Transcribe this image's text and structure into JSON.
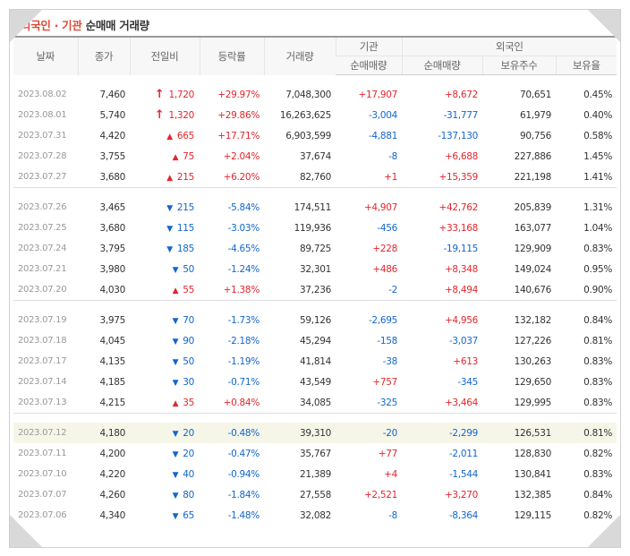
{
  "title": {
    "accent": "외국인 · 기관",
    "rest": "순매매 거래량"
  },
  "headers": {
    "date": "날짜",
    "close": "종가",
    "change": "전일비",
    "rate": "등락률",
    "volume": "거래량",
    "inst": "기관",
    "foreign": "외국인",
    "inst_net": "순매매량",
    "foreign_net": "순매매량",
    "holdings": "보유주수",
    "ratio": "보유율"
  },
  "groups": [
    [
      {
        "date": "2023.08.02",
        "close": "7,460",
        "icon": "upper-limit-arrow-icon",
        "dir": "up",
        "change": "1,720",
        "rate": "+29.97%",
        "volume": "7,048,300",
        "inst": "+17,907",
        "foreign": "+8,672",
        "holdings": "70,651",
        "ratio": "0.45%"
      },
      {
        "date": "2023.08.01",
        "close": "5,740",
        "icon": "upper-limit-arrow-icon",
        "dir": "up",
        "change": "1,320",
        "rate": "+29.86%",
        "volume": "16,263,625",
        "inst": "-3,004",
        "foreign": "-31,777",
        "holdings": "61,979",
        "ratio": "0.40%"
      },
      {
        "date": "2023.07.31",
        "close": "4,420",
        "icon": "up-triangle-icon",
        "dir": "up",
        "change": "665",
        "rate": "+17.71%",
        "volume": "6,903,599",
        "inst": "-4,881",
        "foreign": "-137,130",
        "holdings": "90,756",
        "ratio": "0.58%"
      },
      {
        "date": "2023.07.28",
        "close": "3,755",
        "icon": "up-triangle-icon",
        "dir": "up",
        "change": "75",
        "rate": "+2.04%",
        "volume": "37,674",
        "inst": "-8",
        "foreign": "+6,688",
        "holdings": "227,886",
        "ratio": "1.45%"
      },
      {
        "date": "2023.07.27",
        "close": "3,680",
        "icon": "up-triangle-icon",
        "dir": "up",
        "change": "215",
        "rate": "+6.20%",
        "volume": "82,760",
        "inst": "+1",
        "foreign": "+15,359",
        "holdings": "221,198",
        "ratio": "1.41%"
      }
    ],
    [
      {
        "date": "2023.07.26",
        "close": "3,465",
        "icon": "down-triangle-icon",
        "dir": "down",
        "change": "215",
        "rate": "-5.84%",
        "volume": "174,511",
        "inst": "+4,907",
        "foreign": "+42,762",
        "holdings": "205,839",
        "ratio": "1.31%"
      },
      {
        "date": "2023.07.25",
        "close": "3,680",
        "icon": "down-triangle-icon",
        "dir": "down",
        "change": "115",
        "rate": "-3.03%",
        "volume": "119,936",
        "inst": "-456",
        "foreign": "+33,168",
        "holdings": "163,077",
        "ratio": "1.04%"
      },
      {
        "date": "2023.07.24",
        "close": "3,795",
        "icon": "down-triangle-icon",
        "dir": "down",
        "change": "185",
        "rate": "-4.65%",
        "volume": "89,725",
        "inst": "+228",
        "foreign": "-19,115",
        "holdings": "129,909",
        "ratio": "0.83%"
      },
      {
        "date": "2023.07.21",
        "close": "3,980",
        "icon": "down-triangle-icon",
        "dir": "down",
        "change": "50",
        "rate": "-1.24%",
        "volume": "32,301",
        "inst": "+486",
        "foreign": "+8,348",
        "holdings": "149,024",
        "ratio": "0.95%"
      },
      {
        "date": "2023.07.20",
        "close": "4,030",
        "icon": "up-triangle-icon",
        "dir": "up",
        "change": "55",
        "rate": "+1.38%",
        "volume": "37,236",
        "inst": "-2",
        "foreign": "+8,494",
        "holdings": "140,676",
        "ratio": "0.90%"
      }
    ],
    [
      {
        "date": "2023.07.19",
        "close": "3,975",
        "icon": "down-triangle-icon",
        "dir": "down",
        "change": "70",
        "rate": "-1.73%",
        "volume": "59,126",
        "inst": "-2,695",
        "foreign": "+4,956",
        "holdings": "132,182",
        "ratio": "0.84%"
      },
      {
        "date": "2023.07.18",
        "close": "4,045",
        "icon": "down-triangle-icon",
        "dir": "down",
        "change": "90",
        "rate": "-2.18%",
        "volume": "45,294",
        "inst": "-158",
        "foreign": "-3,037",
        "holdings": "127,226",
        "ratio": "0.81%"
      },
      {
        "date": "2023.07.17",
        "close": "4,135",
        "icon": "down-triangle-icon",
        "dir": "down",
        "change": "50",
        "rate": "-1.19%",
        "volume": "41,814",
        "inst": "-38",
        "foreign": "+613",
        "holdings": "130,263",
        "ratio": "0.83%"
      },
      {
        "date": "2023.07.14",
        "close": "4,185",
        "icon": "down-triangle-icon",
        "dir": "down",
        "change": "30",
        "rate": "-0.71%",
        "volume": "43,549",
        "inst": "+757",
        "foreign": "-345",
        "holdings": "129,650",
        "ratio": "0.83%"
      },
      {
        "date": "2023.07.13",
        "close": "4,215",
        "icon": "up-triangle-icon",
        "dir": "up",
        "change": "35",
        "rate": "+0.84%",
        "volume": "34,085",
        "inst": "-325",
        "foreign": "+3,464",
        "holdings": "129,995",
        "ratio": "0.83%"
      }
    ],
    [
      {
        "date": "2023.07.12",
        "close": "4,180",
        "icon": "down-triangle-icon",
        "dir": "down",
        "change": "20",
        "rate": "-0.48%",
        "volume": "39,310",
        "inst": "-20",
        "foreign": "-2,299",
        "holdings": "126,531",
        "ratio": "0.81%",
        "highlight": true
      },
      {
        "date": "2023.07.11",
        "close": "4,200",
        "icon": "down-triangle-icon",
        "dir": "down",
        "change": "20",
        "rate": "-0.47%",
        "volume": "35,767",
        "inst": "+77",
        "foreign": "-2,011",
        "holdings": "128,830",
        "ratio": "0.82%"
      },
      {
        "date": "2023.07.10",
        "close": "4,220",
        "icon": "down-triangle-icon",
        "dir": "down",
        "change": "40",
        "rate": "-0.94%",
        "volume": "21,389",
        "inst": "+4",
        "foreign": "-1,544",
        "holdings": "130,841",
        "ratio": "0.83%"
      },
      {
        "date": "2023.07.07",
        "close": "4,260",
        "icon": "down-triangle-icon",
        "dir": "down",
        "change": "80",
        "rate": "-1.84%",
        "volume": "27,558",
        "inst": "+2,521",
        "foreign": "+3,270",
        "holdings": "132,385",
        "ratio": "0.84%"
      },
      {
        "date": "2023.07.06",
        "close": "4,340",
        "icon": "down-triangle-icon",
        "dir": "down",
        "change": "65",
        "rate": "-1.48%",
        "volume": "32,082",
        "inst": "-8",
        "foreign": "-8,364",
        "holdings": "129,115",
        "ratio": "0.82%"
      }
    ]
  ],
  "colors": {
    "up": "#e2262d",
    "down": "#1366cc",
    "accent": "#dd4b39",
    "highlight": "#f6f6e8"
  }
}
